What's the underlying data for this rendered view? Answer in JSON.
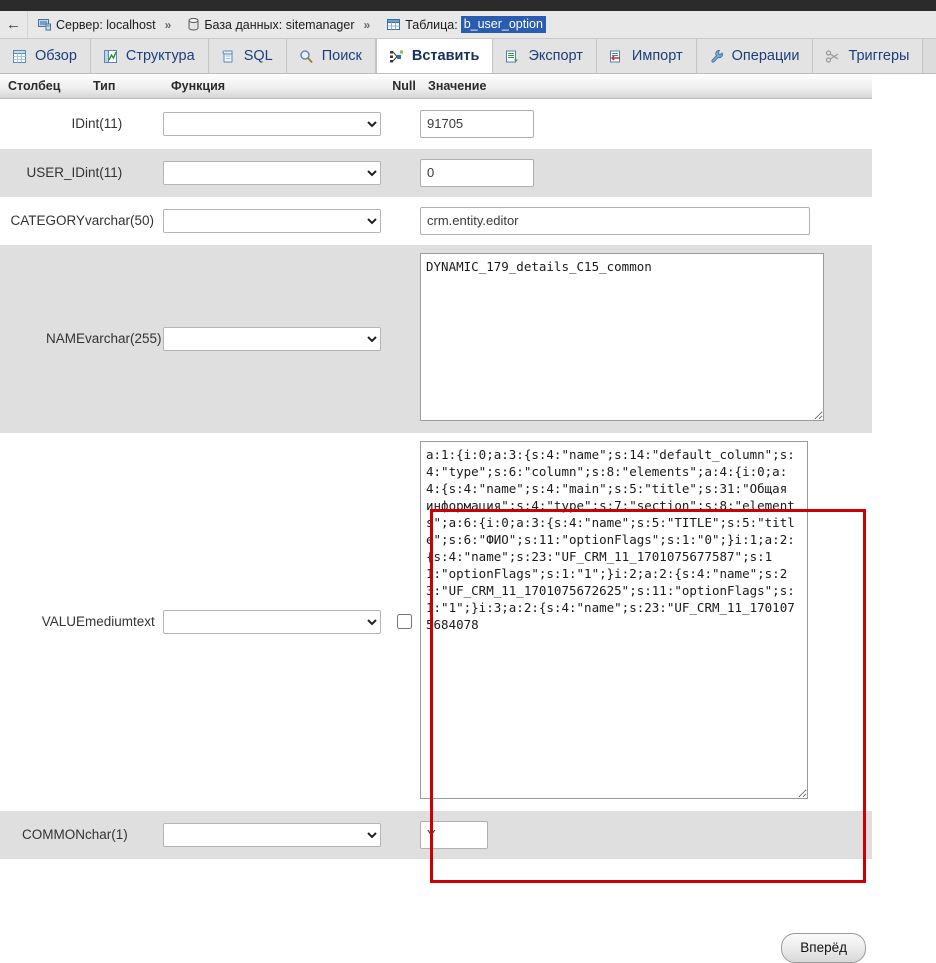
{
  "breadcrumb": {
    "back_label": "←",
    "server_icon": "server-icon",
    "server_label": "Сервер: localhost",
    "sep": "»",
    "database_icon": "database-icon",
    "database_label": "База данных: sitemanager",
    "table_icon": "table-icon",
    "table_label": "Таблица:",
    "table_value": "b_user_option"
  },
  "tabs": [
    {
      "label": "Обзор",
      "icon": "browse-icon",
      "active": false
    },
    {
      "label": "Структура",
      "icon": "structure-icon",
      "active": false
    },
    {
      "label": "SQL",
      "icon": "sql-icon",
      "active": false
    },
    {
      "label": "Поиск",
      "icon": "search-icon",
      "active": false
    },
    {
      "label": "Вставить",
      "icon": "insert-icon",
      "active": true
    },
    {
      "label": "Экспорт",
      "icon": "export-icon",
      "active": false
    },
    {
      "label": "Импорт",
      "icon": "import-icon",
      "active": false
    },
    {
      "label": "Операции",
      "icon": "operations-icon",
      "active": false
    },
    {
      "label": "Триггеры",
      "icon": "triggers-icon",
      "active": false
    }
  ],
  "table_headers": {
    "column": "Столбец",
    "type": "Тип",
    "function": "Функция",
    "null": "Null",
    "value": "Значение"
  },
  "rows": [
    {
      "column": "ID",
      "type": "int(11)",
      "function": "",
      "value": "91705"
    },
    {
      "column": "USER_ID",
      "type": "int(11)",
      "function": "",
      "value": "0"
    },
    {
      "column": "CATEGORY",
      "type": "varchar(50)",
      "function": "",
      "value": "crm.entity.editor"
    },
    {
      "column": "NAME",
      "type": "varchar(255)",
      "function": "",
      "value": "DYNAMIC_179_details_C15_common"
    },
    {
      "column": "VALUE",
      "type": "mediumtext",
      "function": "",
      "value": "a:1:{i:0;a:3:{s:4:\"name\";s:14:\"default_column\";s:4:\"type\";s:6:\"column\";s:8:\"elements\";a:4:{i:0;a:4:{s:4:\"name\";s:4:\"main\";s:5:\"title\";s:31:\"Общая информация\";s:4:\"type\";s:7:\"section\";s:8:\"elements\";a:6:{i:0;a:3:{s:4:\"name\";s:5:\"TITLE\";s:5:\"title\";s:6:\"ФИО\";s:11:\"optionFlags\";s:1:\"0\";}i:1;a:2:{s:4:\"name\";s:23:\"UF_CRM_11_1701075677587\";s:11:\"optionFlags\";s:1:\"1\";}i:2;a:2:{s:4:\"name\";s:23:\"UF_CRM_11_1701075672625\";s:11:\"optionFlags\";s:1:\"1\";}i:3;a:2:{s:4:\"name\";s:23:\"UF_CRM_11_1701075684078"
    },
    {
      "column": "COMMON",
      "type": "char(1)",
      "function": "",
      "value": "Y"
    }
  ],
  "value_row_null_checked": false,
  "submit": {
    "label": "Вперёд"
  },
  "colors": {
    "accent_blue": "#1c3f7a",
    "selection_blue": "#2a5db0",
    "highlight_red": "#cc0000",
    "row_even": "#dfdfdf",
    "header_gray": "#dcdcdc"
  }
}
